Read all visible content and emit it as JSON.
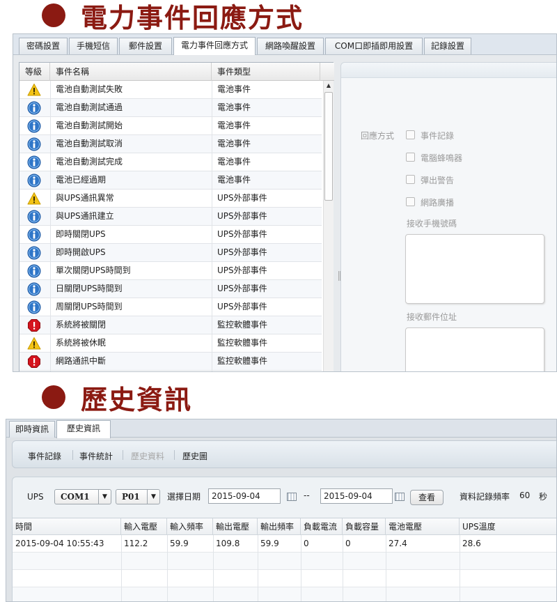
{
  "section1_title": "電力事件回應方式",
  "section2_title": "歷史資訊",
  "colors": {
    "heading": "#8b1a12",
    "info_icon": "#2f76c8",
    "warning_icon": "#f3c316",
    "error_icon": "#d5141e"
  },
  "settings_tabs": [
    "密碼設置",
    "手機短信",
    "郵件設置",
    "電力事件回應方式",
    "網路喚醒設置",
    "COM口即插即用設置",
    "記錄設置"
  ],
  "event_table": {
    "headers": [
      "等級",
      "事件名稱",
      "事件類型"
    ],
    "rows": [
      {
        "level": "warning-icon",
        "name": "電池自動測試失敗",
        "type": "電池事件"
      },
      {
        "level": "info-icon",
        "name": "電池自動測試通過",
        "type": "電池事件"
      },
      {
        "level": "info-icon",
        "name": "電池自動測試開始",
        "type": "電池事件"
      },
      {
        "level": "info-icon",
        "name": "電池自動測試取消",
        "type": "電池事件"
      },
      {
        "level": "info-icon",
        "name": "電池自動測試完成",
        "type": "電池事件"
      },
      {
        "level": "info-icon",
        "name": "電池已經過期",
        "type": "電池事件"
      },
      {
        "level": "warning-icon",
        "name": "與UPS通訊異常",
        "type": "UPS外部事件"
      },
      {
        "level": "info-icon",
        "name": "與UPS通訊建立",
        "type": "UPS外部事件"
      },
      {
        "level": "info-icon",
        "name": "即時關閉UPS",
        "type": "UPS外部事件"
      },
      {
        "level": "info-icon",
        "name": "即時開啟UPS",
        "type": "UPS外部事件"
      },
      {
        "level": "info-icon",
        "name": "單次關閉UPS時間到",
        "type": "UPS外部事件"
      },
      {
        "level": "info-icon",
        "name": "日關閉UPS時間到",
        "type": "UPS外部事件"
      },
      {
        "level": "info-icon",
        "name": "周關閉UPS時間到",
        "type": "UPS外部事件"
      },
      {
        "level": "error-icon",
        "name": "系統將被關閉",
        "type": "監控軟體事件"
      },
      {
        "level": "warning-icon",
        "name": "系統將被休眠",
        "type": "監控軟體事件"
      },
      {
        "level": "error-icon",
        "name": "網路通訊中斷",
        "type": "監控軟體事件"
      }
    ]
  },
  "response": {
    "label": "回應方式",
    "options": [
      {
        "label": "事件記錄",
        "checked": false
      },
      {
        "label": "電腦蜂鳴器",
        "checked": false
      },
      {
        "label": "彈出警告",
        "checked": false
      },
      {
        "label": "網路廣播",
        "checked": false
      }
    ],
    "phone_label": "接收手機號碼",
    "email_label": "接收郵件位址"
  },
  "history_tabs": [
    "即時資訊",
    "歷史資訊"
  ],
  "history_subtabs": [
    "事件記錄",
    "事件統計",
    "歷史資料",
    "歷史圖"
  ],
  "filter": {
    "ups_label": "UPS",
    "com_value": "COM1",
    "port_value": "P01",
    "date_label": "選擇日期",
    "date_from": "2015-09-04",
    "separator": "--",
    "date_to": "2015-09-04",
    "query_button": "查看",
    "rate_label": "資料記錄頻率",
    "rate_value": "60",
    "rate_unit": "秒"
  },
  "history_table": {
    "headers": [
      "時間",
      "輸入電壓",
      "輸入頻率",
      "輸出電壓",
      "輸出頻率",
      "負載電流",
      "負載容量",
      "電池電壓",
      "UPS溫度"
    ],
    "rows": [
      [
        "2015-09-04 10:55:43",
        "112.2",
        "59.9",
        "109.8",
        "59.9",
        "0",
        "0",
        "27.4",
        "28.6"
      ]
    ]
  }
}
